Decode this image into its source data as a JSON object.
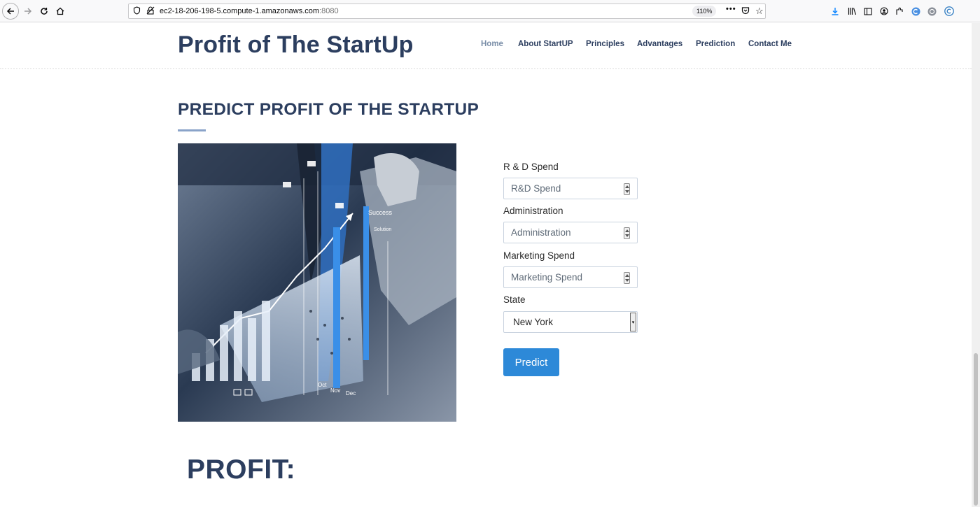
{
  "browser": {
    "url_host": "ec2-18-206-198-5.compute-1.amazonaws.com",
    "url_port": ":8080",
    "zoom": "110%"
  },
  "site": {
    "title": "Profit of The StartUp",
    "nav": [
      "Home",
      "About StartUP",
      "Principles",
      "Advantages",
      "Prediction",
      "Contact Me"
    ],
    "active_nav": "Home"
  },
  "section": {
    "title": "PREDICT PROFIT OF THE STARTUP"
  },
  "form": {
    "rd_label": "R & D Spend",
    "rd_placeholder": "R&D Spend",
    "admin_label": "Administration",
    "admin_placeholder": "Administration",
    "marketing_label": "Marketing Spend",
    "marketing_placeholder": "Marketing Spend",
    "state_label": "State",
    "state_value": "New York",
    "predict_label": "Predict"
  },
  "result": {
    "heading": "PROFIT:"
  },
  "colors": {
    "heading": "#2c3e5f",
    "accent": "#2d89d8"
  }
}
